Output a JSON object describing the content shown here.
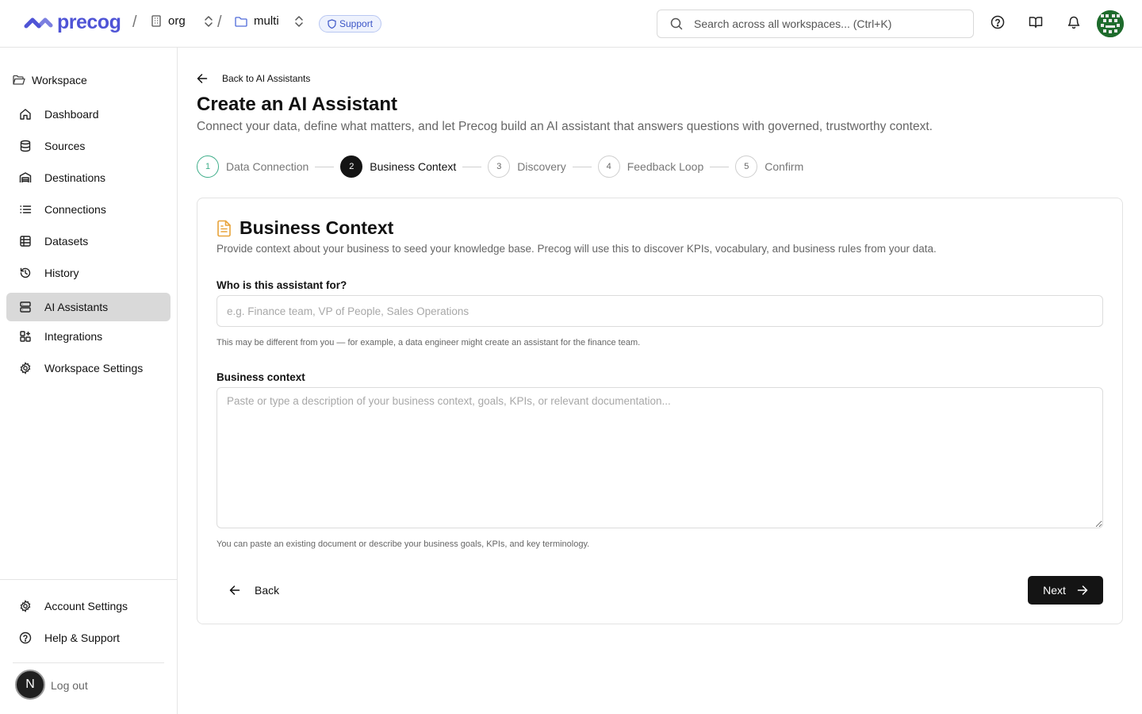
{
  "topbar": {
    "logo_text": "precog",
    "org_label": "org",
    "project_label": "multi",
    "support_label": "Support",
    "search_placeholder": "Search across all workspaces... (Ctrl+K)",
    "colors": {
      "brand": "#4f54d6",
      "support_badge": "#3b55c7"
    }
  },
  "sidebar": {
    "workspace_label": "Workspace",
    "items": [
      {
        "label": "Dashboard",
        "icon": "home-icon"
      },
      {
        "label": "Sources",
        "icon": "database-icon"
      },
      {
        "label": "Destinations",
        "icon": "warehouse-icon"
      },
      {
        "label": "Connections",
        "icon": "list-icon"
      },
      {
        "label": "Datasets",
        "icon": "table-icon"
      },
      {
        "label": "History",
        "icon": "history-icon"
      },
      {
        "label": "AI Assistants",
        "icon": "server-icon",
        "active": true
      },
      {
        "label": "Integrations",
        "icon": "puzzle-icon"
      },
      {
        "label": "Workspace Settings",
        "icon": "gear-icon"
      }
    ],
    "footer": {
      "account_settings": "Account Settings",
      "help_support": "Help & Support",
      "avatar_initial": "N",
      "logout": "Log out"
    }
  },
  "main": {
    "back_link": "Back to AI Assistants",
    "title": "Create an AI Assistant",
    "subtitle": "Connect your data, define what matters, and let Precog build an AI assistant that answers questions with governed, trustworthy context.",
    "steps": [
      {
        "number": "1",
        "label": "Data Connection",
        "state": "done"
      },
      {
        "number": "2",
        "label": "Business Context",
        "state": "current"
      },
      {
        "number": "3",
        "label": "Discovery",
        "state": "upcoming"
      },
      {
        "number": "4",
        "label": "Feedback Loop",
        "state": "upcoming"
      },
      {
        "number": "5",
        "label": "Confirm",
        "state": "upcoming"
      }
    ],
    "card": {
      "title": "Business Context",
      "description": "Provide context about your business to seed your knowledge base. Precog will use this to discover KPIs, vocabulary, and business rules from your data.",
      "audience_label": "Who is this assistant for?",
      "audience_value": "",
      "audience_placeholder": "e.g. Finance team, VP of People, Sales Operations",
      "audience_hint": "This may be different from you — for example, a data engineer might create an assistant for the finance team.",
      "context_label": "Business context",
      "context_value": "",
      "context_placeholder": "Paste or type a description of your business context, goals, KPIs, or relevant documentation...",
      "context_hint": "You can paste an existing document or describe your business goals, KPIs, and key terminology.",
      "back_button": "Back",
      "next_button": "Next"
    },
    "colors": {
      "step_done": "#3fae8a",
      "step_current": "#141414",
      "title_icon": "#e8a33a"
    }
  }
}
